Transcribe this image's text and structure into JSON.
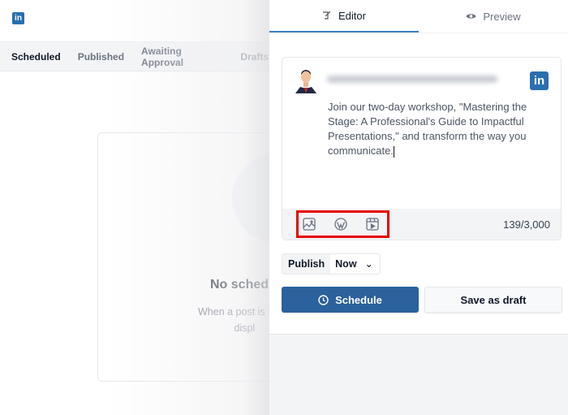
{
  "left": {
    "logo": "in",
    "tabs": [
      "Scheduled",
      "Published",
      "Awaiting Approval",
      "Drafts"
    ],
    "active_tab": "Scheduled",
    "empty": {
      "title": "No sched",
      "desc_line1": "When a post is",
      "desc_line2": "displ"
    }
  },
  "right": {
    "tabs": {
      "editor": "Editor",
      "preview": "Preview"
    },
    "card": {
      "network_logo": "in",
      "text": "Join our two-day workshop, \"Mastering the Stage: A Professional's Guide to Impactful Presentations,\" and transform the way you communicate.",
      "icons": [
        "image-icon",
        "wordpress-icon",
        "video-icon"
      ],
      "char_count": "139/3,000"
    },
    "publish": {
      "label": "Publish",
      "value": "Now"
    },
    "schedule_label": "Schedule",
    "draft_label": "Save as draft",
    "colors": {
      "accent": "#2b619c",
      "highlight": "#e60000",
      "linkedin": "#2a6fb0"
    }
  }
}
